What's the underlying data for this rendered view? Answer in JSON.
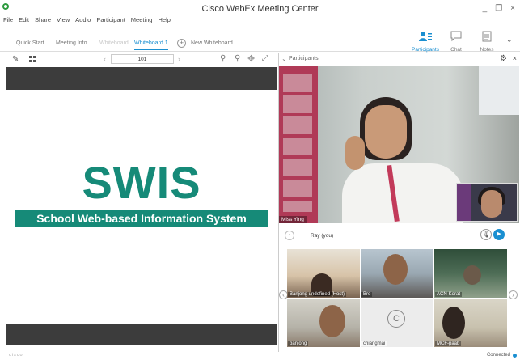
{
  "window": {
    "title": "Cisco WebEx Meeting Center",
    "controls": [
      "_",
      "❐",
      "×"
    ]
  },
  "menu": [
    "File",
    "Edit",
    "Share",
    "View",
    "Audio",
    "Participant",
    "Meeting",
    "Help"
  ],
  "tabs": [
    {
      "label": "Quick Start",
      "state": "normal"
    },
    {
      "label": "Meeting Info",
      "state": "normal"
    },
    {
      "label": "Whiteboard",
      "state": "dim"
    },
    {
      "label": "Whiteboard 1",
      "state": "active"
    }
  ],
  "new_whiteboard_label": "New Whiteboard",
  "right_tools": [
    {
      "label": "Participants",
      "icon": "participants-icon",
      "active": true
    },
    {
      "label": "Chat",
      "icon": "chat-icon",
      "active": false
    },
    {
      "label": "Notes",
      "icon": "notes-icon",
      "active": false
    }
  ],
  "whiteboard": {
    "page_value": "101",
    "logo_text": "SWIS",
    "banner_text": "School Web-based Information System",
    "accent_color": "#168a78"
  },
  "panel": {
    "title": "Participants",
    "main_video_name": "Miss Ying",
    "active_speaker": "Ray (you)"
  },
  "thumbnails": [
    {
      "name": "Banjong undefined (Host)"
    },
    {
      "name": "Bro"
    },
    {
      "name": "ACN-Korat"
    },
    {
      "name": "banjong"
    },
    {
      "name": "chiangmai",
      "avatar_letter": "C"
    },
    {
      "name": "MCF-paab"
    }
  ],
  "status": {
    "brand": "cisco",
    "connection": "Connected"
  },
  "colors": {
    "accent_blue": "#1a8fd1",
    "wb_band": "#3c3c3c"
  }
}
